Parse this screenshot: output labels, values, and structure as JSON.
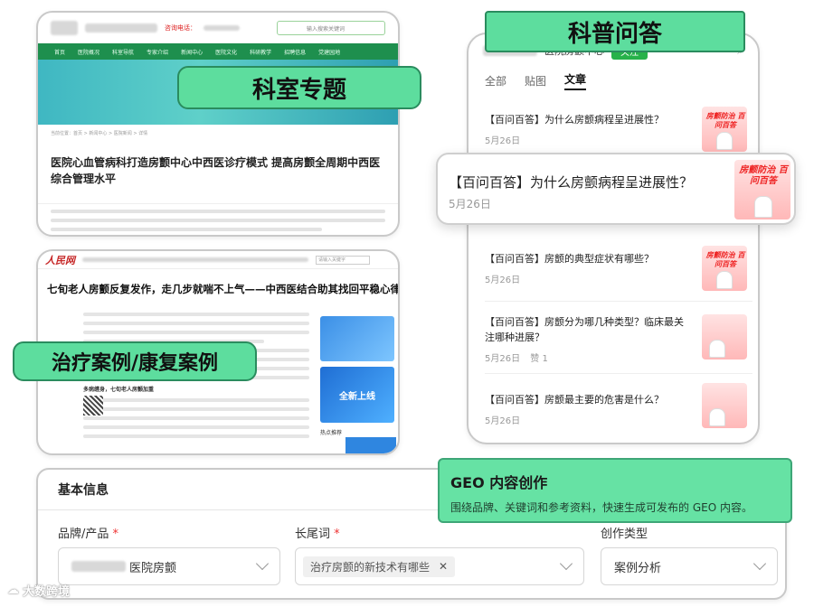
{
  "badges": {
    "dept_topic": "科室专题",
    "science_qa": "科普问答",
    "treatment_cases": "治疗案例/康复案例"
  },
  "card1": {
    "hotline_label": "咨询电话：",
    "search_placeholder": "输入搜索关键词",
    "nav": [
      "首页",
      "医院概况",
      "科室导航",
      "专家介绍",
      "新闻中心",
      "医院文化",
      "科研教学",
      "招聘信息",
      "党建园地"
    ],
    "title": "医院心血管病科打造房颤中心中西医诊疗模式 提高房颤全周期中西医综合管理水平",
    "crumb": "当前位置：首页 > 新闻中心 > 医院新闻 > 详情"
  },
  "card2": {
    "logo": "人民网",
    "title": "七旬老人房颤反复发作，走几步就喘不上气——中西医结合助其找回平稳心律",
    "subhead": "多病缠身，七旬老人房颤加重",
    "ad_text": "全新上线",
    "hot": "热点推荐",
    "search_placeholder": "请输入关键字"
  },
  "phone": {
    "account": "医院房颤中心",
    "follow": "关注",
    "tabs": [
      "全部",
      "贴图",
      "文章"
    ],
    "active_tab": "文章",
    "thumb_text": "房颤防治 百问百答",
    "items": [
      {
        "title": "【百问百答】为什么房颤病程呈进展性？",
        "date": "5月26日"
      },
      {
        "title": "【百问百答】房颤的典型症状有哪些？",
        "date": "5月26日"
      },
      {
        "title": "【百问百答】房颤分为哪几种类型？临床最关注哪种进展？",
        "date": "5月26日",
        "likes": "赞 1"
      },
      {
        "title": "【百问百答】房颤最主要的危害是什么？",
        "date": "5月26日"
      }
    ]
  },
  "popup": {
    "title": "【百问百答】为什么房颤病程呈进展性？",
    "date": "5月26日"
  },
  "form": {
    "section_title": "基本信息",
    "brand_label": "品牌/产品",
    "brand_value": "医院房颤",
    "keyword_label": "长尾词",
    "keyword_tag": "治疗房颤的新技术有哪些",
    "type_label": "创作类型",
    "type_value": "案例分析",
    "required_mark": "*"
  },
  "geo": {
    "title": "GEO 内容创作",
    "subtitle": "围绕品牌、关键词和参考资料，快速生成可发布的 GEO 内容。"
  },
  "watermark": "大数跨境"
}
